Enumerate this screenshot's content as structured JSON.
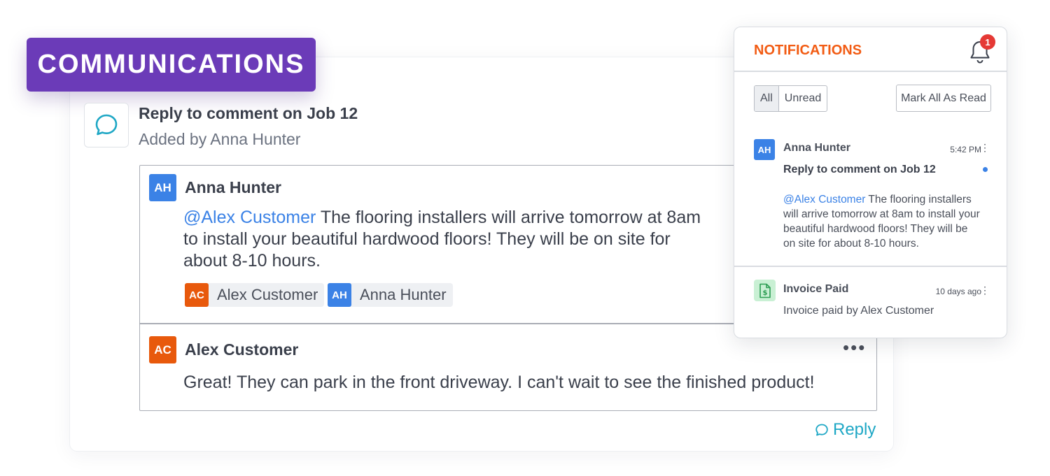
{
  "badge": {
    "label": "COMMUNICATIONS"
  },
  "thread": {
    "title": "Reply to comment on Job 12",
    "subtitle": "Added by Anna Hunter",
    "messages": [
      {
        "initials": "AH",
        "author": "Anna Hunter",
        "mention": "@Alex Customer",
        "text_line1": " The flooring installers will arrive tomorrow at 8am",
        "text_line2": "to install your beautiful hardwood floors! They will be on site for",
        "text_line3": "about 8-10 hours.",
        "tagged": [
          {
            "initials": "AC",
            "name": "Alex Customer"
          },
          {
            "initials": "AH",
            "name": "Anna Hunter"
          }
        ]
      },
      {
        "initials": "AC",
        "author": "Alex Customer",
        "text": "Great! They can park in the front driveway. I can't wait to see the finished product!",
        "more": "•••"
      }
    ],
    "reply_label": "Reply"
  },
  "notifications": {
    "title": "NOTIFICATIONS",
    "badge_count": "1",
    "filters": {
      "all": "All",
      "unread": "Unread",
      "active": "All"
    },
    "mark_all": "Mark All As Read",
    "items": [
      {
        "initials": "AH",
        "author": "Anna Hunter",
        "time": "5:42 PM",
        "subject": "Reply to comment on Job 12",
        "mention": "@Alex Customer",
        "line1": " The flooring installers",
        "line2": "will arrive tomorrow at 8am to install your",
        "line3": "beautiful hardwood floors! They will be",
        "line4": "on site for about 8-10 hours.",
        "unread": true
      },
      {
        "icon": "invoice-dollar-icon",
        "title": "Invoice Paid",
        "time": "10 days ago",
        "body": "Invoice paid by Alex Customer"
      }
    ]
  },
  "colors": {
    "badge_bg": "#6b3bb8",
    "notif_title": "#f25c14",
    "mention": "#3b82e6",
    "reply": "#1ea7c5",
    "avatar_ah": "#3b82e6",
    "avatar_ac": "#e8590c"
  }
}
